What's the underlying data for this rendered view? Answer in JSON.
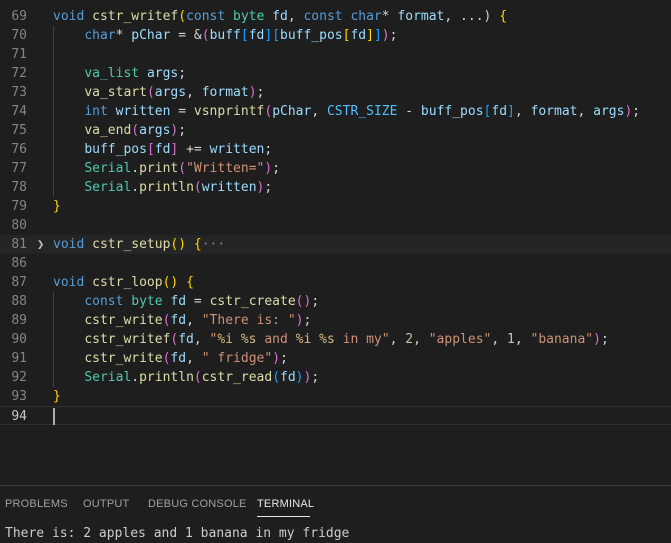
{
  "editor": {
    "lines": [
      {
        "num": "69",
        "tokens": [
          [
            "k",
            "void "
          ],
          [
            "f",
            "cstr_writef"
          ],
          [
            "b1",
            "("
          ],
          [
            "k",
            "const "
          ],
          [
            "t",
            "byte "
          ],
          [
            "v",
            "fd"
          ],
          [
            "p",
            ", "
          ],
          [
            "k",
            "const "
          ],
          [
            "k",
            "char"
          ],
          [
            "p",
            "* "
          ],
          [
            "v",
            "format"
          ],
          [
            "p",
            ", ...) "
          ],
          [
            "b1",
            "{"
          ]
        ]
      },
      {
        "num": "70",
        "tokens": [
          [
            "p",
            "    "
          ],
          [
            "k",
            "char"
          ],
          [
            "p",
            "* "
          ],
          [
            "v",
            "pChar"
          ],
          [
            "p",
            " = &"
          ],
          [
            "b2",
            "("
          ],
          [
            "v",
            "buff"
          ],
          [
            "b3",
            "["
          ],
          [
            "v",
            "fd"
          ],
          [
            "b3",
            "]"
          ],
          [
            "b3",
            "["
          ],
          [
            "v",
            "buff_pos"
          ],
          [
            "b1",
            "["
          ],
          [
            "v",
            "fd"
          ],
          [
            "b1",
            "]"
          ],
          [
            "b3",
            "]"
          ],
          [
            "b2",
            ")"
          ],
          [
            "p",
            ";"
          ]
        ]
      },
      {
        "num": "71",
        "tokens": []
      },
      {
        "num": "72",
        "tokens": [
          [
            "p",
            "    "
          ],
          [
            "t",
            "va_list "
          ],
          [
            "v",
            "args"
          ],
          [
            "p",
            ";"
          ]
        ]
      },
      {
        "num": "73",
        "tokens": [
          [
            "p",
            "    "
          ],
          [
            "f",
            "va_start"
          ],
          [
            "b2",
            "("
          ],
          [
            "v",
            "args"
          ],
          [
            "p",
            ", "
          ],
          [
            "v",
            "format"
          ],
          [
            "b2",
            ")"
          ],
          [
            "p",
            ";"
          ]
        ]
      },
      {
        "num": "74",
        "tokens": [
          [
            "p",
            "    "
          ],
          [
            "k",
            "int "
          ],
          [
            "v",
            "written"
          ],
          [
            "p",
            " = "
          ],
          [
            "f",
            "vsnprintf"
          ],
          [
            "b2",
            "("
          ],
          [
            "v",
            "pChar"
          ],
          [
            "p",
            ", "
          ],
          [
            "c",
            "CSTR_SIZE"
          ],
          [
            "p",
            " - "
          ],
          [
            "v",
            "buff_pos"
          ],
          [
            "b3",
            "["
          ],
          [
            "v",
            "fd"
          ],
          [
            "b3",
            "]"
          ],
          [
            "p",
            ", "
          ],
          [
            "v",
            "format"
          ],
          [
            "p",
            ", "
          ],
          [
            "v",
            "args"
          ],
          [
            "b2",
            ")"
          ],
          [
            "p",
            ";"
          ]
        ]
      },
      {
        "num": "75",
        "tokens": [
          [
            "p",
            "    "
          ],
          [
            "f",
            "va_end"
          ],
          [
            "b2",
            "("
          ],
          [
            "v",
            "args"
          ],
          [
            "b2",
            ")"
          ],
          [
            "p",
            ";"
          ]
        ]
      },
      {
        "num": "76",
        "tokens": [
          [
            "p",
            "    "
          ],
          [
            "v",
            "buff_pos"
          ],
          [
            "b2",
            "["
          ],
          [
            "v",
            "fd"
          ],
          [
            "b2",
            "]"
          ],
          [
            "p",
            " += "
          ],
          [
            "v",
            "written"
          ],
          [
            "p",
            ";"
          ]
        ]
      },
      {
        "num": "77",
        "tokens": [
          [
            "p",
            "    "
          ],
          [
            "t",
            "Serial"
          ],
          [
            "p",
            "."
          ],
          [
            "f",
            "print"
          ],
          [
            "b2",
            "("
          ],
          [
            "s",
            "\"Written=\""
          ],
          [
            "b2",
            ")"
          ],
          [
            "p",
            ";"
          ]
        ]
      },
      {
        "num": "78",
        "tokens": [
          [
            "p",
            "    "
          ],
          [
            "t",
            "Serial"
          ],
          [
            "p",
            "."
          ],
          [
            "f",
            "println"
          ],
          [
            "b2",
            "("
          ],
          [
            "v",
            "written"
          ],
          [
            "b2",
            ")"
          ],
          [
            "p",
            ";"
          ]
        ]
      },
      {
        "num": "79",
        "tokens": [
          [
            "b1",
            "}"
          ]
        ]
      },
      {
        "num": "80",
        "tokens": []
      },
      {
        "num": "81",
        "folded": true,
        "tokens": [
          [
            "k",
            "void "
          ],
          [
            "f",
            "cstr_setup"
          ],
          [
            "b1",
            "() {"
          ],
          [
            "ell",
            "···"
          ]
        ]
      },
      {
        "num": "86",
        "tokens": []
      },
      {
        "num": "87",
        "tokens": [
          [
            "k",
            "void "
          ],
          [
            "f",
            "cstr_loop"
          ],
          [
            "b1",
            "() {"
          ]
        ]
      },
      {
        "num": "88",
        "tokens": [
          [
            "p",
            "    "
          ],
          [
            "k",
            "const "
          ],
          [
            "t",
            "byte "
          ],
          [
            "v",
            "fd"
          ],
          [
            "p",
            " = "
          ],
          [
            "f",
            "cstr_create"
          ],
          [
            "b2",
            "()"
          ],
          [
            "p",
            ";"
          ]
        ]
      },
      {
        "num": "89",
        "tokens": [
          [
            "p",
            "    "
          ],
          [
            "f",
            "cstr_write"
          ],
          [
            "b2",
            "("
          ],
          [
            "v",
            "fd"
          ],
          [
            "p",
            ", "
          ],
          [
            "s",
            "\"There is: \""
          ],
          [
            "b2",
            ")"
          ],
          [
            "p",
            ";"
          ]
        ]
      },
      {
        "num": "90",
        "tokens": [
          [
            "p",
            "    "
          ],
          [
            "f",
            "cstr_writef"
          ],
          [
            "b2",
            "("
          ],
          [
            "v",
            "fd"
          ],
          [
            "p",
            ", "
          ],
          [
            "s",
            "\""
          ],
          [
            "esc",
            "%i"
          ],
          [
            "s",
            " "
          ],
          [
            "esc",
            "%s"
          ],
          [
            "s",
            " and "
          ],
          [
            "esc",
            "%i"
          ],
          [
            "s",
            " "
          ],
          [
            "esc",
            "%s"
          ],
          [
            "s",
            " in my\""
          ],
          [
            "p",
            ", "
          ],
          [
            "n",
            "2"
          ],
          [
            "p",
            ", "
          ],
          [
            "s",
            "\"apples\""
          ],
          [
            "p",
            ", "
          ],
          [
            "n",
            "1"
          ],
          [
            "p",
            ", "
          ],
          [
            "s",
            "\"banana\""
          ],
          [
            "b2",
            ")"
          ],
          [
            "p",
            ";"
          ]
        ]
      },
      {
        "num": "91",
        "tokens": [
          [
            "p",
            "    "
          ],
          [
            "f",
            "cstr_write"
          ],
          [
            "b2",
            "("
          ],
          [
            "v",
            "fd"
          ],
          [
            "p",
            ", "
          ],
          [
            "s",
            "\" fridge\""
          ],
          [
            "b2",
            ")"
          ],
          [
            "p",
            ";"
          ]
        ]
      },
      {
        "num": "92",
        "tokens": [
          [
            "p",
            "    "
          ],
          [
            "t",
            "Serial"
          ],
          [
            "p",
            "."
          ],
          [
            "f",
            "println"
          ],
          [
            "b2",
            "("
          ],
          [
            "f",
            "cstr_read"
          ],
          [
            "b3",
            "("
          ],
          [
            "v",
            "fd"
          ],
          [
            "b3",
            ")"
          ],
          [
            "b2",
            ")"
          ],
          [
            "p",
            ";"
          ]
        ]
      },
      {
        "num": "93",
        "tokens": [
          [
            "b1",
            "}"
          ]
        ]
      },
      {
        "num": "94",
        "current": true,
        "tokens": []
      }
    ]
  },
  "panel": {
    "tabs": [
      {
        "label": "PROBLEMS",
        "active": false
      },
      {
        "label": "OUTPUT",
        "active": false
      },
      {
        "label": "DEBUG CONSOLE",
        "active": false
      },
      {
        "label": "TERMINAL",
        "active": true
      }
    ],
    "terminal_output": "There is: 2 apples and 1 banana in my fridge"
  },
  "colors": {
    "background": "#1e1e1e",
    "keyword": "#569cd6",
    "function": "#dcdcaa",
    "type": "#4ec9b0",
    "variable": "#9cdcfe",
    "string": "#ce9178",
    "number": "#b5cea8"
  },
  "icons": {
    "fold": "chevron-right-icon"
  }
}
